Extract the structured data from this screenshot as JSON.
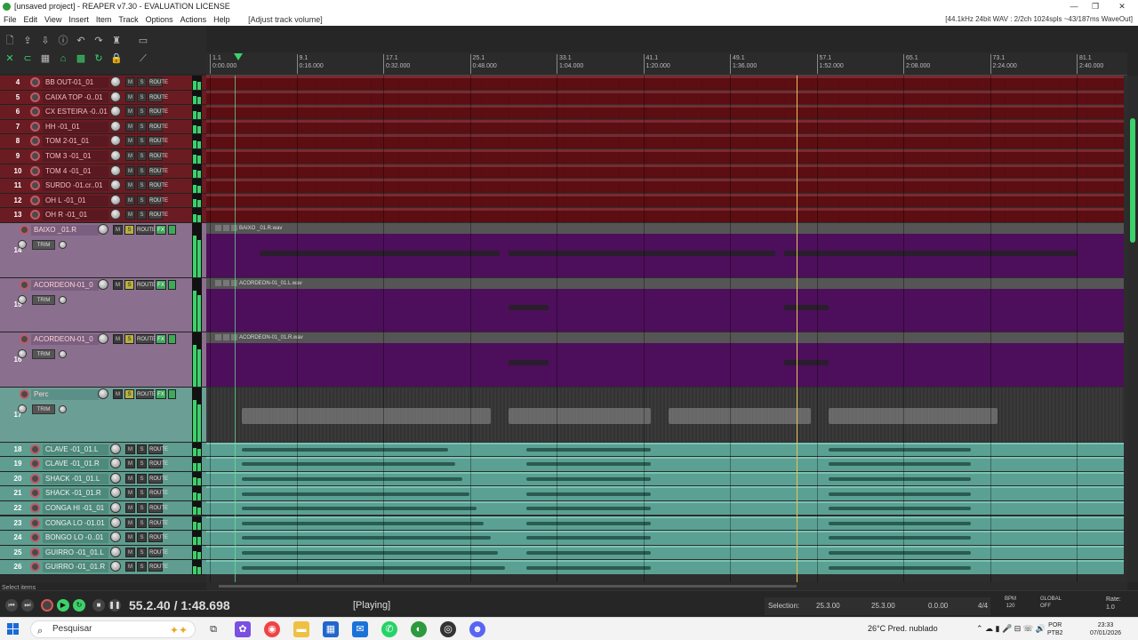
{
  "window": {
    "title": "[unsaved project] - REAPER v7.30 - EVALUATION LICENSE",
    "controls": [
      "—",
      "❐",
      "✕"
    ]
  },
  "menu": {
    "items": [
      "File",
      "Edit",
      "View",
      "Insert",
      "Item",
      "Track",
      "Options",
      "Actions",
      "Help"
    ],
    "hint": "[Adjust track volume]",
    "info": "[44.1kHz 24bit WAV : 2/2ch 1024spls ~43/187ms WaveOut]"
  },
  "ruler": {
    "marks": [
      [
        "1.1",
        "0:00.000"
      ],
      [
        "9.1",
        "0:16.000"
      ],
      [
        "17.1",
        "0:32.000"
      ],
      [
        "25.1",
        "0:48.000"
      ],
      [
        "33.1",
        "1:04.000"
      ],
      [
        "41.1",
        "1:20.000"
      ],
      [
        "49.1",
        "1:36.000"
      ],
      [
        "57.1",
        "1:52.000"
      ],
      [
        "65.1",
        "2:08.000"
      ],
      [
        "73.1",
        "2:24.000"
      ],
      [
        "81.1",
        "2:40.000"
      ]
    ]
  },
  "track_labels": {
    "mute": "M",
    "solo": "S",
    "route": "ROUTE",
    "fx": "FX",
    "trim": "TRIM"
  },
  "tracks": [
    {
      "num": "4",
      "name": "BB OUT-01_01",
      "style": "red"
    },
    {
      "num": "5",
      "name": "CAIXA TOP -0..01",
      "style": "red"
    },
    {
      "num": "6",
      "name": "CX ESTEIRA -0..01",
      "style": "red"
    },
    {
      "num": "7",
      "name": "HH -01_01",
      "style": "red"
    },
    {
      "num": "8",
      "name": "TOM 2-01_01",
      "style": "red"
    },
    {
      "num": "9",
      "name": "TOM 3 -01_01",
      "style": "red"
    },
    {
      "num": "10",
      "name": "TOM 4 -01_01",
      "style": "red"
    },
    {
      "num": "11",
      "name": "SURDO -01.cr..01",
      "style": "red"
    },
    {
      "num": "12",
      "name": "OH L -01_01",
      "style": "red"
    },
    {
      "num": "13",
      "name": "OH R -01_01",
      "style": "red"
    },
    {
      "num": "14",
      "name": "BAIXO _01.R",
      "style": "purple",
      "clip": "BAIXO _01.R.wav"
    },
    {
      "num": "15",
      "name": "ACORDEON-01_0",
      "style": "purple",
      "clip": "ACORDEON-01_01.L.wav"
    },
    {
      "num": "16",
      "name": "ACORDEON-01_0",
      "style": "purple",
      "clip": "ACORDEON-01_01.R.wav"
    },
    {
      "num": "17",
      "name": "Perc",
      "style": "grey"
    },
    {
      "num": "18",
      "name": "CLAVE -01_01.L",
      "style": "teal"
    },
    {
      "num": "19",
      "name": "CLAVE -01_01.R",
      "style": "teal"
    },
    {
      "num": "20",
      "name": "SHACK -01_01.L",
      "style": "teal"
    },
    {
      "num": "21",
      "name": "SHACK -01_01.R",
      "style": "teal"
    },
    {
      "num": "22",
      "name": "CONGA HI -01_01",
      "style": "teal"
    },
    {
      "num": "23",
      "name": "CONGA LO -01.01",
      "style": "teal"
    },
    {
      "num": "24",
      "name": "BONGO LO -0..01",
      "style": "teal"
    },
    {
      "num": "25",
      "name": "GUIRRO -01_01.L",
      "style": "teal"
    },
    {
      "num": "26",
      "name": "GUIRRO -01_01.R",
      "style": "teal"
    }
  ],
  "transport": {
    "position": "55.2.40 / 1:48.698",
    "state": "[Playing]"
  },
  "selection": {
    "label": "Selection:",
    "start": "25.3.00",
    "end": "25.3.00",
    "length": "0.0.00",
    "timesig": "4/4"
  },
  "tempo": {
    "label": "BPM",
    "value": "120"
  },
  "global": {
    "label": "GLOBAL",
    "value": "OFF"
  },
  "rate": {
    "label": "Rate:",
    "value": "1.0"
  },
  "statushint": "Select items",
  "taskbar": {
    "search_placeholder": "Pesquisar",
    "weather": "26°C  Pred. nublado",
    "lang_top": "POR",
    "lang_bottom": "PTB2",
    "time": "23:33",
    "date": "07/01/2026"
  },
  "colors": {
    "accent": "#3dd16a",
    "cursor": "#e8c35a",
    "red_track": "#5c0e12",
    "purple_lane": "#4d0f5b",
    "teal_lane": "#5aa193"
  }
}
